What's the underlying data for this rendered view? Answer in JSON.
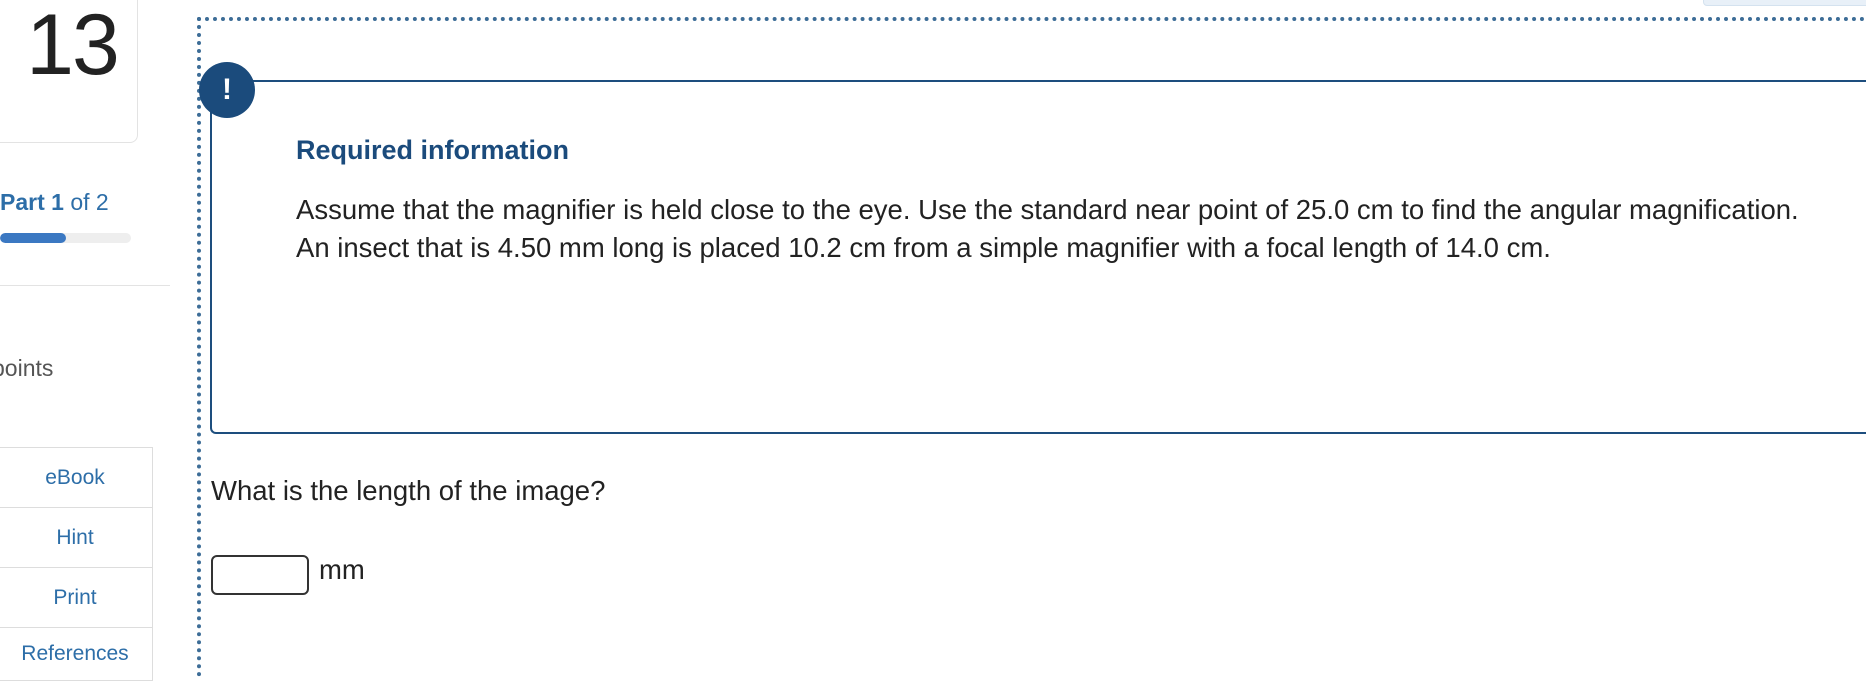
{
  "question": {
    "number": "13",
    "part_prefix": "Part ",
    "part_current": "1",
    "part_suffix": " of 2",
    "progress_fraction": 0.5,
    "points_label": "points"
  },
  "sidebar": {
    "buttons": [
      {
        "label": "eBook"
      },
      {
        "label": "Hint"
      },
      {
        "label": "Print"
      },
      {
        "label": "References"
      }
    ]
  },
  "info": {
    "icon_glyph": "!",
    "title": "Required information",
    "body": "Assume that the magnifier is held close to the eye. Use the standard near point of 25.0 cm to find the angular magnification. An insect that is 4.50 mm long is placed 10.2 cm from a simple magnifier with a focal length of 14.0 cm."
  },
  "prompt": {
    "text": "What is the length of the image?",
    "answer_value": "",
    "unit": "mm"
  },
  "colors": {
    "accent": "#1b4b7c",
    "link": "#2d6ea8",
    "progress": "#3b78c2"
  },
  "icons": {
    "alert": "exclamation-icon"
  }
}
